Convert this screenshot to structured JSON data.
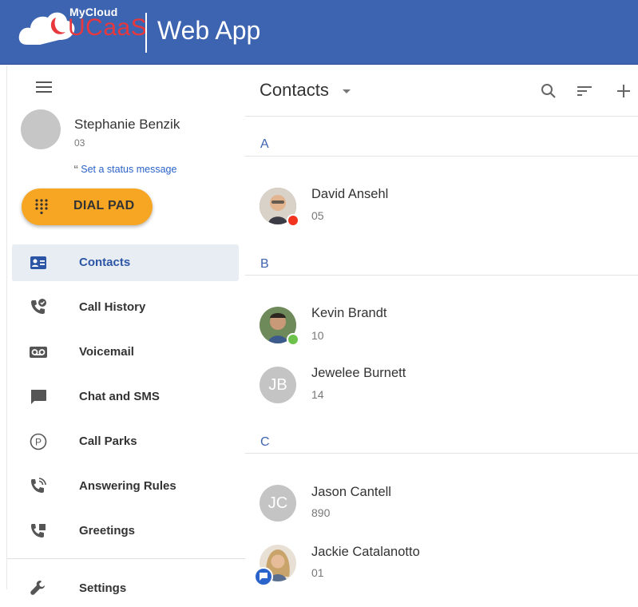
{
  "app": {
    "brand_top": "MyCloud",
    "brand_bottom": "UCaaS",
    "title": "Web App"
  },
  "user": {
    "name": "Stephanie Benzik",
    "extension": "03",
    "status_prompt": "Set a status message"
  },
  "dialpad": {
    "label": "DIAL PAD"
  },
  "nav": {
    "items": [
      {
        "label": "Contacts",
        "icon": "contacts-card-icon",
        "active": true
      },
      {
        "label": "Call History",
        "icon": "call-history-icon"
      },
      {
        "label": "Voicemail",
        "icon": "voicemail-icon"
      },
      {
        "label": "Chat and SMS",
        "icon": "chat-icon"
      },
      {
        "label": "Call Parks",
        "icon": "call-park-icon"
      },
      {
        "label": "Answering Rules",
        "icon": "answering-rules-icon"
      },
      {
        "label": "Greetings",
        "icon": "greetings-icon"
      },
      {
        "label": "Settings",
        "icon": "settings-icon"
      }
    ]
  },
  "contacts": {
    "title": "Contacts",
    "groups": [
      {
        "letter": "A",
        "contacts": [
          {
            "name": "David Ansehl",
            "ext": "05",
            "presence": "busy"
          }
        ]
      },
      {
        "letter": "B",
        "contacts": [
          {
            "name": "Kevin Brandt",
            "ext": "10",
            "presence": "online"
          },
          {
            "name": "Jewelee Burnett",
            "ext": "14",
            "initials": "JB"
          }
        ]
      },
      {
        "letter": "C",
        "contacts": [
          {
            "name": "Jason Cantell",
            "ext": "890",
            "initials": "JC"
          },
          {
            "name": "Jackie Catalanotto",
            "ext": "01",
            "badge": "chat"
          }
        ]
      }
    ]
  },
  "colors": {
    "header": "#3d64b0",
    "brand_red": "#e8383d",
    "dialpad": "#f6a623",
    "accent": "#2c56a5",
    "busy": "#f1331f",
    "online": "#6cc24a"
  }
}
